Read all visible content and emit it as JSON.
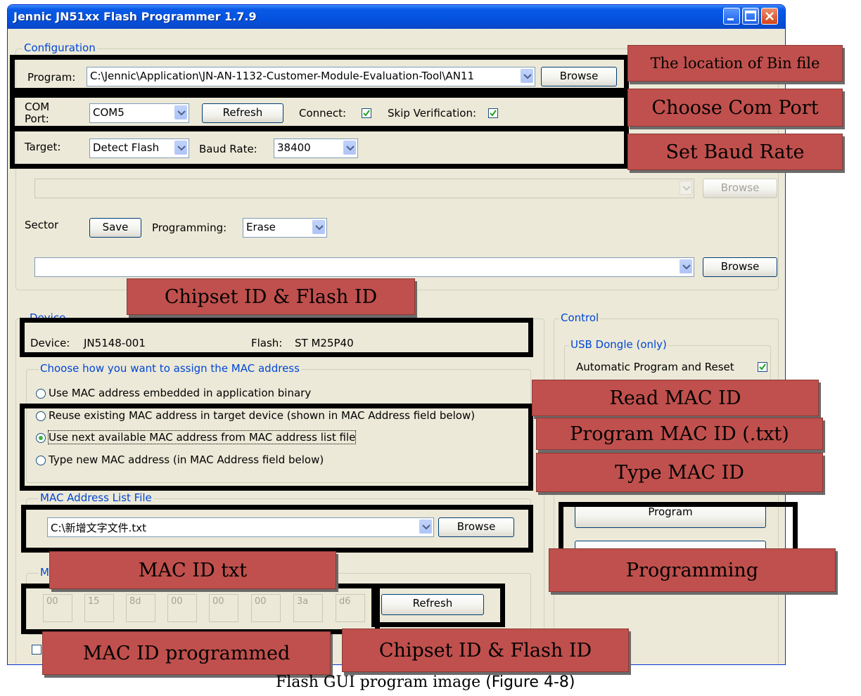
{
  "window": {
    "title": "Jennic JN51xx Flash Programmer 1.7.9"
  },
  "configuration": {
    "legend": "Configuration",
    "program_label": "Program:",
    "program_path": "C:\\Jennic\\Application\\JN-AN-1132-Customer-Module-Evaluation-Tool\\AN11",
    "browse": "Browse",
    "com_port_label": "COM Port:",
    "com_port": "COM5",
    "refresh": "Refresh",
    "connect_label": "Connect:",
    "connect_checked": true,
    "skip_verification_label": "Skip Verification:",
    "skip_verification_checked": true,
    "target_label": "Target:",
    "target": "Detect Flash",
    "baud_rate_label": "Baud Rate:",
    "baud_rate": "38400",
    "secondary_browse": "Browse",
    "sector_label": "Sector",
    "save": "Save",
    "programming_label": "Programming:",
    "programming": "Erase",
    "third_browse": "Browse"
  },
  "device": {
    "legend": "Device",
    "device_label": "Device:",
    "device_value": "JN5148-001",
    "flash_label": "Flash:",
    "flash_value": "ST M25P40"
  },
  "mac_assign": {
    "legend": "Choose how you want to assign the MAC address",
    "options": [
      "Use MAC address embedded in application binary",
      "Reuse existing MAC address in target device (shown in MAC Address field below)",
      "Use next available MAC address from MAC address list file",
      "Type new MAC address (in MAC Address field below)"
    ],
    "selected_index": 2
  },
  "mac_list_file": {
    "legend": "MAC Address List File",
    "path": "C:\\新增文字文件.txt",
    "browse": "Browse"
  },
  "mac_address": {
    "legend": "M",
    "bytes": [
      "00",
      "15",
      "8d",
      "00",
      "00",
      "00",
      "3a",
      "d6"
    ],
    "refresh": "Refresh"
  },
  "control": {
    "legend": "Control",
    "usb_legend": "USB Dongle (only)",
    "auto_label": "Automatic Program and Reset",
    "auto_checked": true,
    "program_button": "Program"
  },
  "annotations": {
    "bin_location": "The location of Bin file",
    "com_port": "Choose Com Port",
    "baud_rate": "Set Baud Rate",
    "chipset_flash_top": "Chipset ID & Flash ID",
    "read_mac": "Read MAC ID",
    "program_mac": "Program MAC ID (.txt)",
    "type_mac": "Type MAC ID",
    "programming": "Programming",
    "mac_txt": "MAC ID txt",
    "mac_programmed": "MAC ID programmed",
    "chipset_flash_bottom": "Chipset ID & Flash ID"
  },
  "caption": {
    "text": "Flash GUI program image",
    "figure": "(Figure 4-8)"
  },
  "colors": {
    "titlebar": "#0452de",
    "tag_fill": "#c0504d",
    "legend_text": "#0046d5",
    "window_bg": "#ece9d8"
  }
}
